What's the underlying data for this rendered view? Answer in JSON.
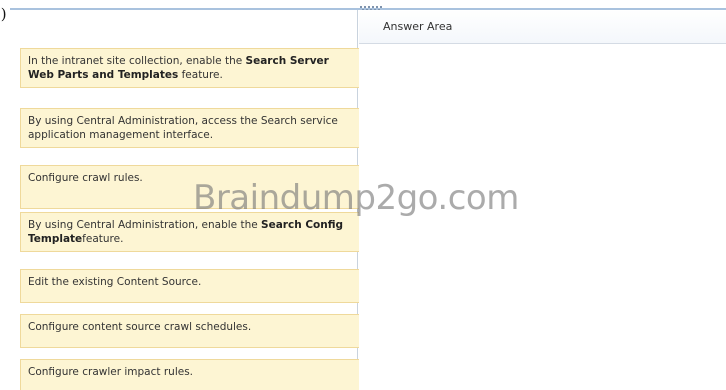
{
  "question_number_suffix": ".)",
  "answer_area": {
    "label": "Answer Area"
  },
  "items": [
    {
      "pre": "In the intranet site collection, enable the ",
      "bold": "Search Server Web Parts and Templates",
      "post": " feature."
    },
    {
      "pre": "By using Central Administration, access the Search service application management interface.",
      "bold": "",
      "post": ""
    },
    {
      "pre": "Configure crawl rules.",
      "bold": "",
      "post": ""
    },
    {
      "pre": "By using Central Administration, enable the ",
      "bold": "Search Config Template",
      "post": "feature."
    },
    {
      "pre": "Edit the existing Content Source.",
      "bold": "",
      "post": ""
    },
    {
      "pre": "Configure content source crawl schedules.",
      "bold": "",
      "post": ""
    },
    {
      "pre": "Configure crawler impact rules.",
      "bold": "",
      "post": ""
    }
  ],
  "watermark": "Braindump2go.com",
  "colors": {
    "card_bg": "#fdf5d3",
    "card_border": "#efd99b",
    "divider": "#a9c2de"
  }
}
